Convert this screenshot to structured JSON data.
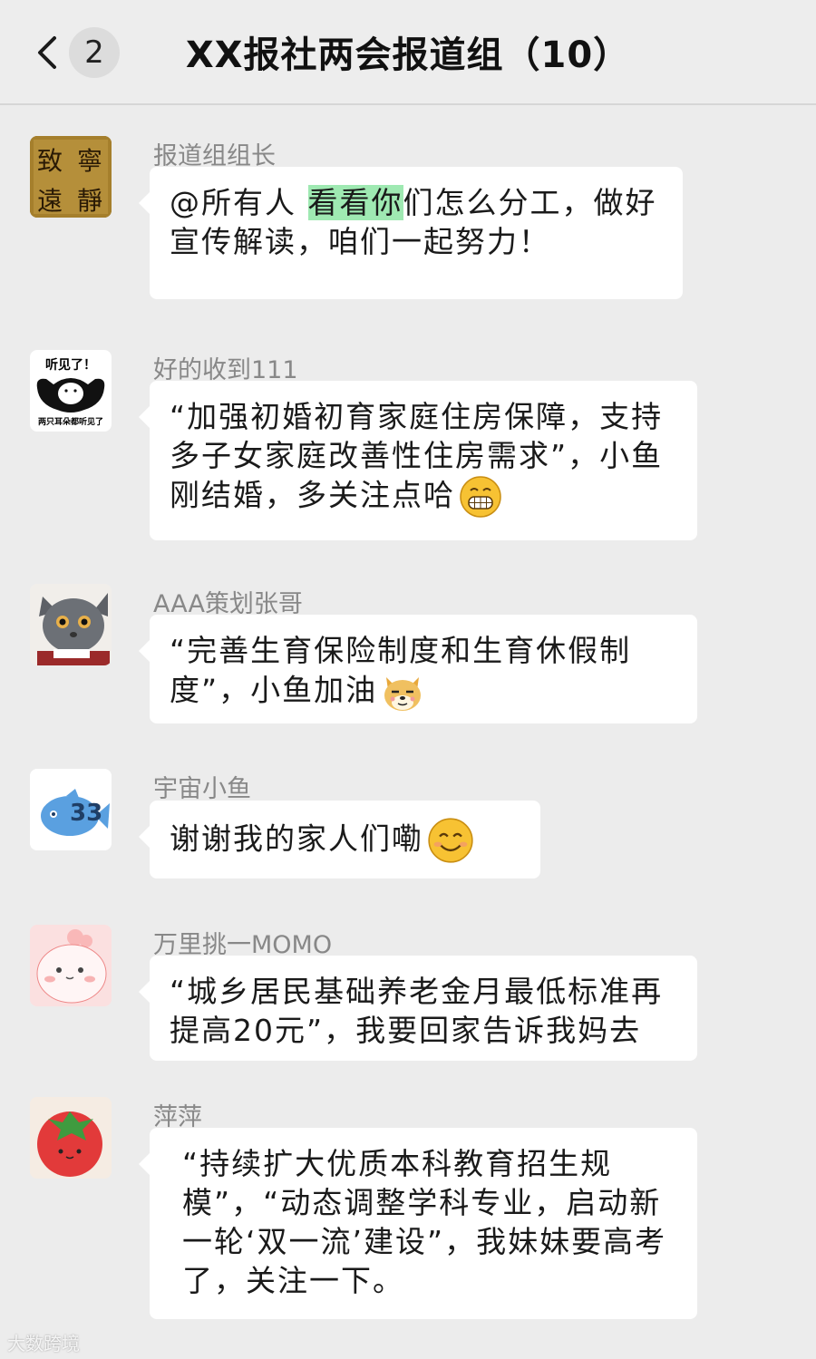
{
  "header": {
    "unread_count": "2",
    "title": "XX报社两会报道组（10）"
  },
  "avatars": {
    "seal_chars": [
      "致",
      "寧",
      "遠",
      "靜"
    ],
    "meme_top": "听见了！",
    "meme_bottom": "两只耳朵都听见了",
    "fish_text": "33"
  },
  "messages": [
    {
      "sender": "报道组组长",
      "segments": [
        "@所有人 ",
        "看看你",
        "们怎么分工，做好宣传解读，咱们一起努力！"
      ]
    },
    {
      "sender": "好的收到111",
      "text": "“加强初婚初育家庭住房保障，支持多子女家庭改善性住房需求”，小鱼刚结婚，多关注点哈",
      "emoji": "grin-emoji"
    },
    {
      "sender": "AAA策划张哥",
      "text": "“完善生育保险制度和生育休假制度”，小鱼加油",
      "emoji": "doge-emoji"
    },
    {
      "sender": "宇宙小鱼",
      "text": "谢谢我的家人们嘞",
      "emoji": "smile-emoji"
    },
    {
      "sender": "万里挑一MOMO",
      "text": "“城乡居民基础养老金月最低标准再提高20元”，我要回家告诉我妈去"
    },
    {
      "sender": "萍萍",
      "text": "“持续扩大优质本科教育招生规模”，“动态调整学科专业，启动新一轮‘双一流’建设”，我妹妹要高考了，关注一下。"
    }
  ],
  "watermark": "大数跨境",
  "colors": {
    "background": "#ececec",
    "bubble": "#ffffff",
    "highlight": "#9fe9b2",
    "sender": "#888888"
  }
}
